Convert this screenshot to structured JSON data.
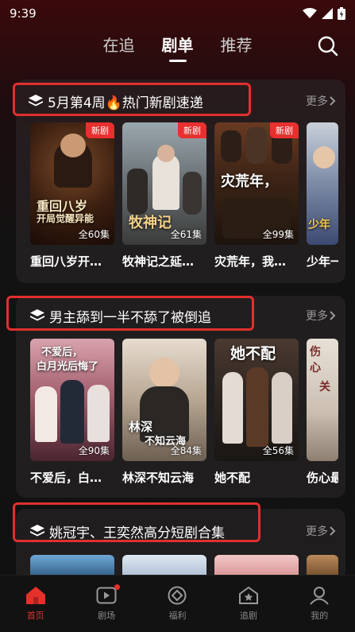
{
  "status": {
    "time": "9:39"
  },
  "tabs": [
    {
      "label": "在追"
    },
    {
      "label": "剧单"
    },
    {
      "label": "推荐"
    }
  ],
  "sections": [
    {
      "title": "5月第4周🔥热门新剧速递",
      "more": "更多",
      "cards": [
        {
          "title": "重回八岁开…",
          "badge": "新剧",
          "episodes": "全60集"
        },
        {
          "title": "牧神记之延…",
          "badge": "新剧",
          "episodes": "全61集"
        },
        {
          "title": "灾荒年，我…",
          "badge": "新剧",
          "episodes": "全99集"
        },
        {
          "title": "少年一",
          "badge": "",
          "episodes": ""
        }
      ]
    },
    {
      "title": "男主舔到一半不舔了被倒追",
      "more": "更多",
      "cards": [
        {
          "title": "不爱后，白…",
          "episodes": "全90集"
        },
        {
          "title": "林深不知云海",
          "episodes": "全84集"
        },
        {
          "title": "她不配",
          "episodes": "全56集"
        },
        {
          "title": "伤心最",
          "episodes": ""
        }
      ]
    },
    {
      "title": "姚冠宇、王奕然高分短剧合集",
      "more": "更多"
    }
  ],
  "bottom_nav": [
    {
      "label": "首页",
      "active": true
    },
    {
      "label": "剧场"
    },
    {
      "label": "福利"
    },
    {
      "label": "追剧"
    },
    {
      "label": "我的"
    }
  ],
  "colors": {
    "accent": "#e7302b",
    "highlight_box": "#e0302f"
  }
}
